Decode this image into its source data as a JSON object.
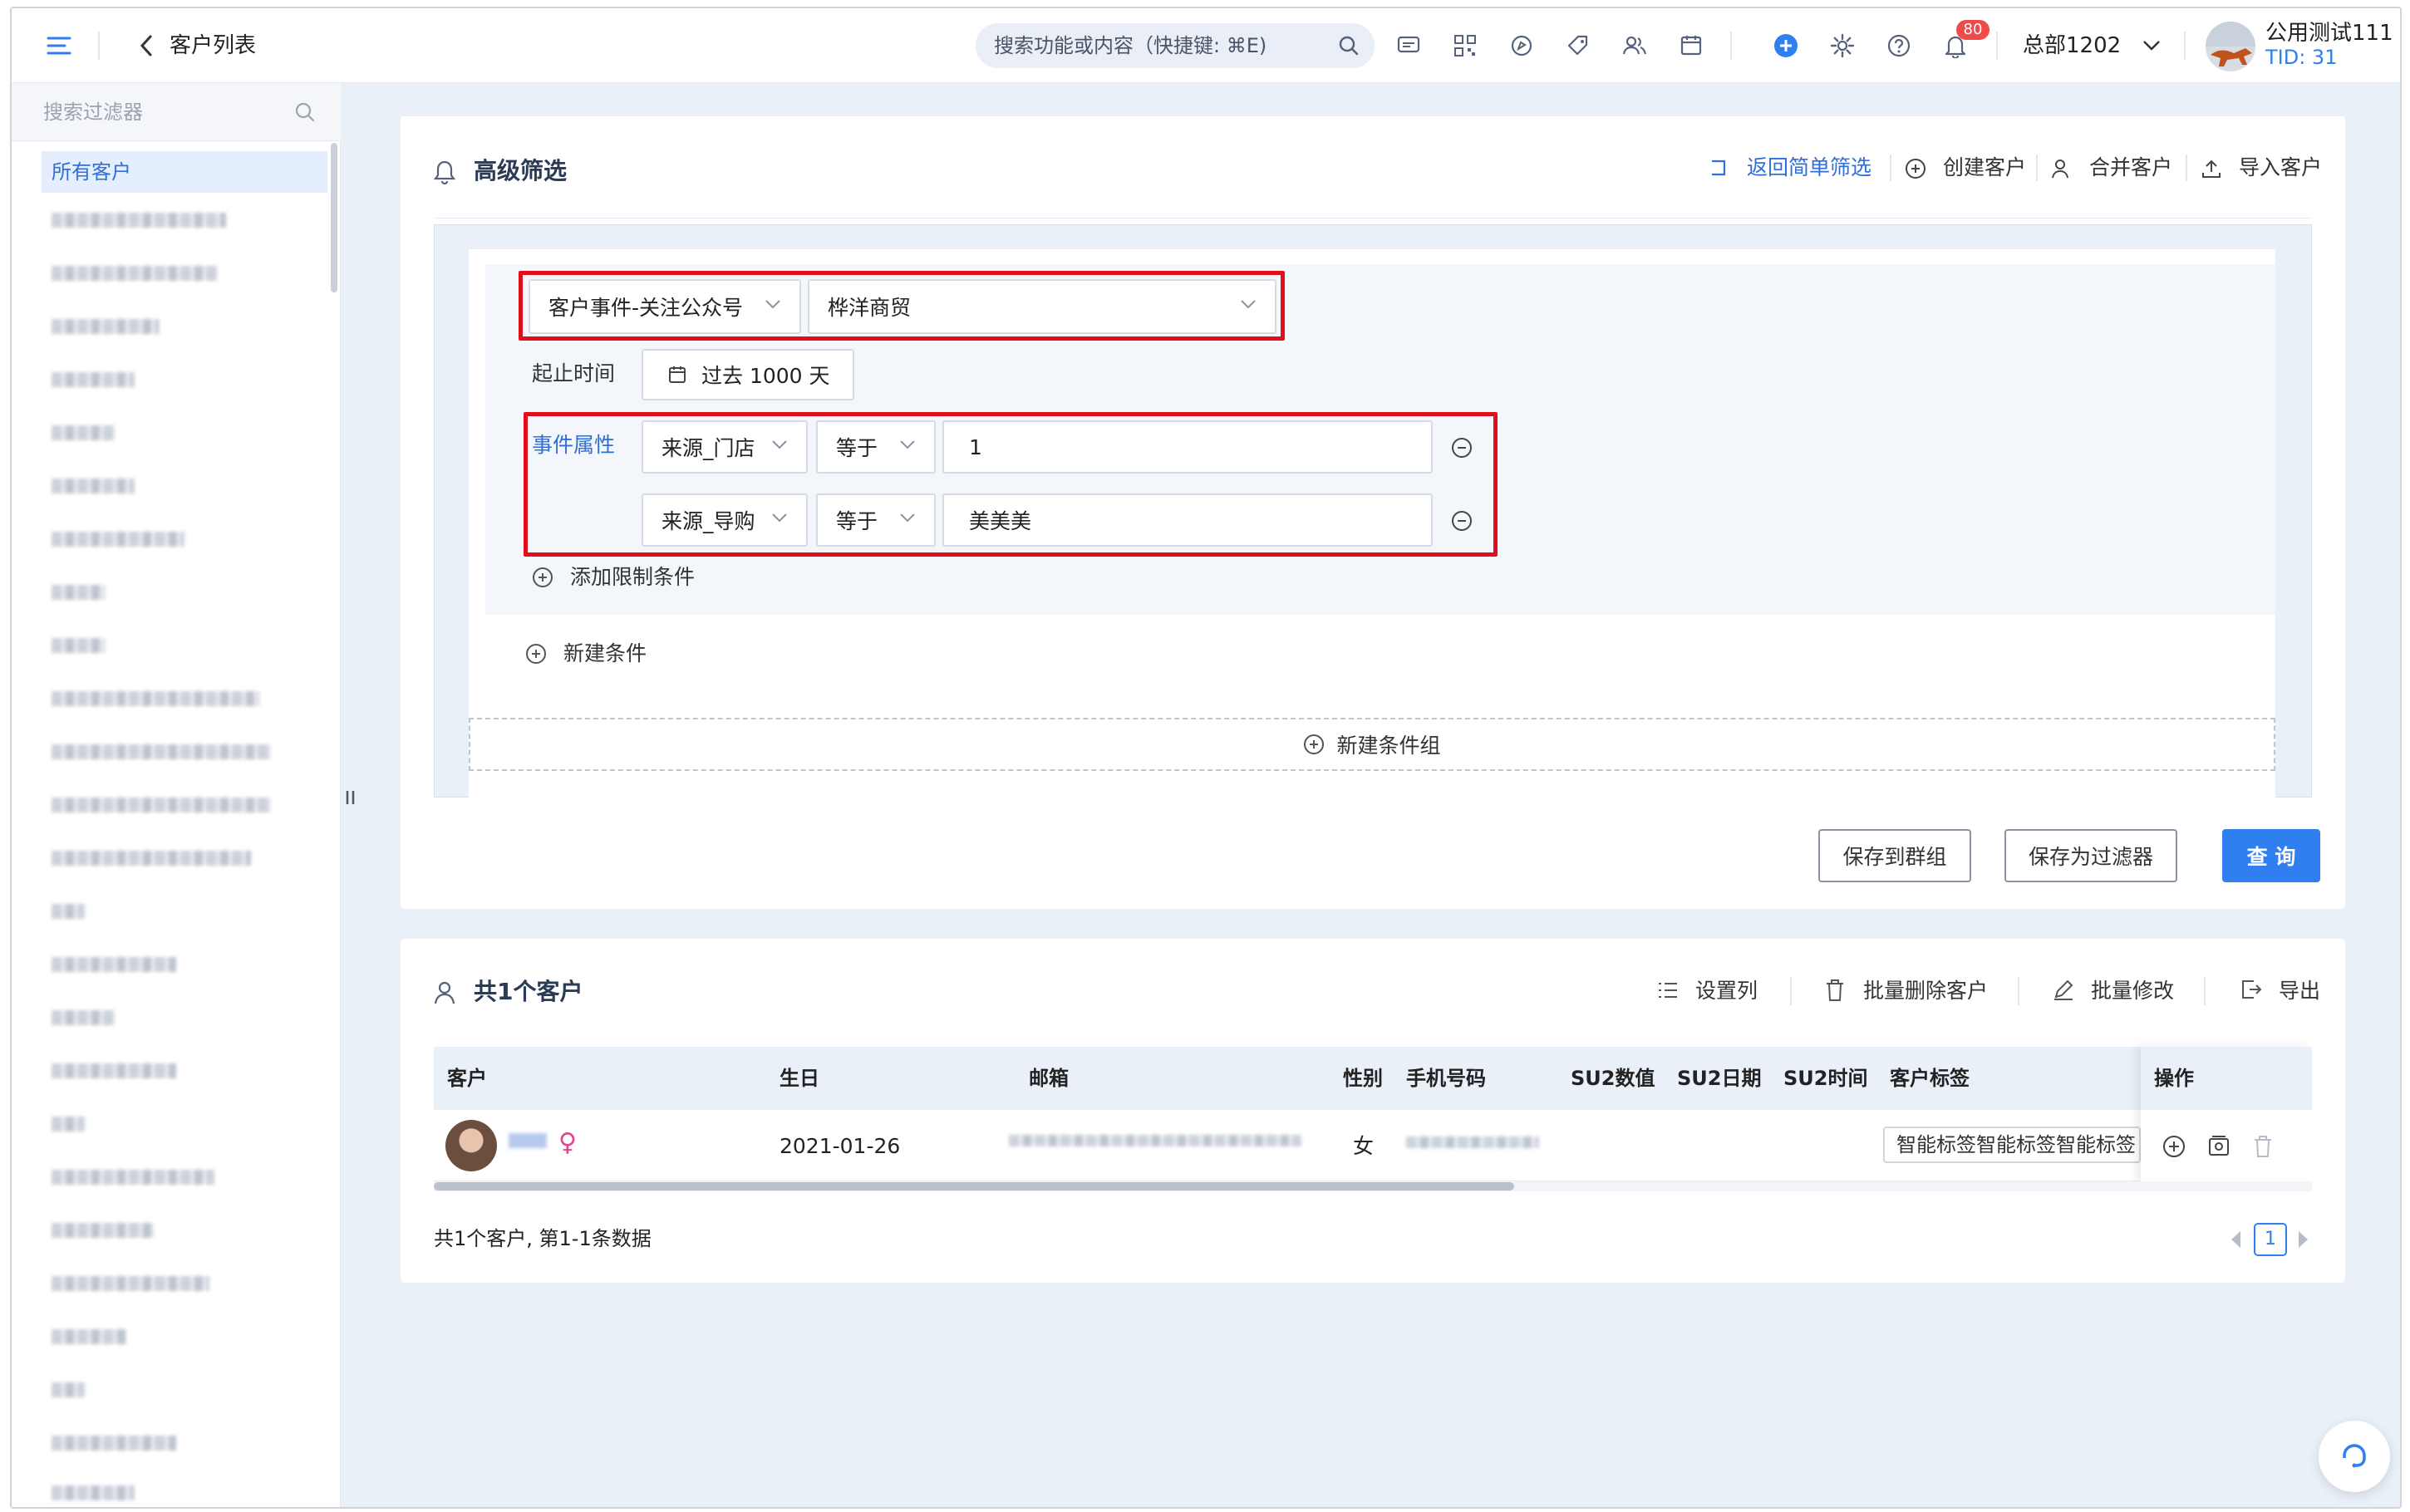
{
  "topbar": {
    "back_label": "客户列表",
    "search_placeholder": "搜索功能或内容（快捷键: ⌘E)",
    "notification_count": "80",
    "org_name": "总部1202",
    "user_name": "公用测试111",
    "tid": "TID: 31"
  },
  "sidebar": {
    "search_placeholder": "搜索过滤器",
    "active_item": "所有客户"
  },
  "filter": {
    "title": "高级筛选",
    "actions": {
      "back_simple": "返回简单筛选",
      "create": "创建客户",
      "merge": "合并客户",
      "import": "导入客户"
    },
    "event_select": "客户事件-关注公众号",
    "account_select": "桦洋商贸",
    "time_label": "起止时间",
    "time_value": "过去 1000 天",
    "property_label": "事件属性",
    "conditions": [
      {
        "field": "来源_门店",
        "op": "等于",
        "value": "1"
      },
      {
        "field": "来源_导购",
        "op": "等于",
        "value": "美美美"
      }
    ],
    "add_limit": "添加限制条件",
    "new_condition": "新建条件",
    "new_group": "新建条件组",
    "save_group": "保存到群组",
    "save_filter": "保存为过滤器",
    "query": "查 询"
  },
  "results": {
    "title": "共1个客户",
    "actions": {
      "columns": "设置列",
      "batch_delete": "批量删除客户",
      "batch_edit": "批量修改",
      "export": "导出"
    },
    "columns": [
      "客户",
      "生日",
      "邮箱",
      "性别",
      "手机号码",
      "SU2数值",
      "SU2日期",
      "SU2时间",
      "客户标签",
      "操作"
    ],
    "rows": [
      {
        "birthday": "2021-01-26",
        "gender": "女",
        "gender_symbol": "♀",
        "tags": "智能标签智能标签智能标签"
      }
    ],
    "footer": "共1个客户, 第1-1条数据",
    "page": "1"
  },
  "colors": {
    "accent": "#2f7ff0",
    "highlight": "#e0101a",
    "badge": "#f04a4a",
    "bg": "#eaf0f8"
  }
}
